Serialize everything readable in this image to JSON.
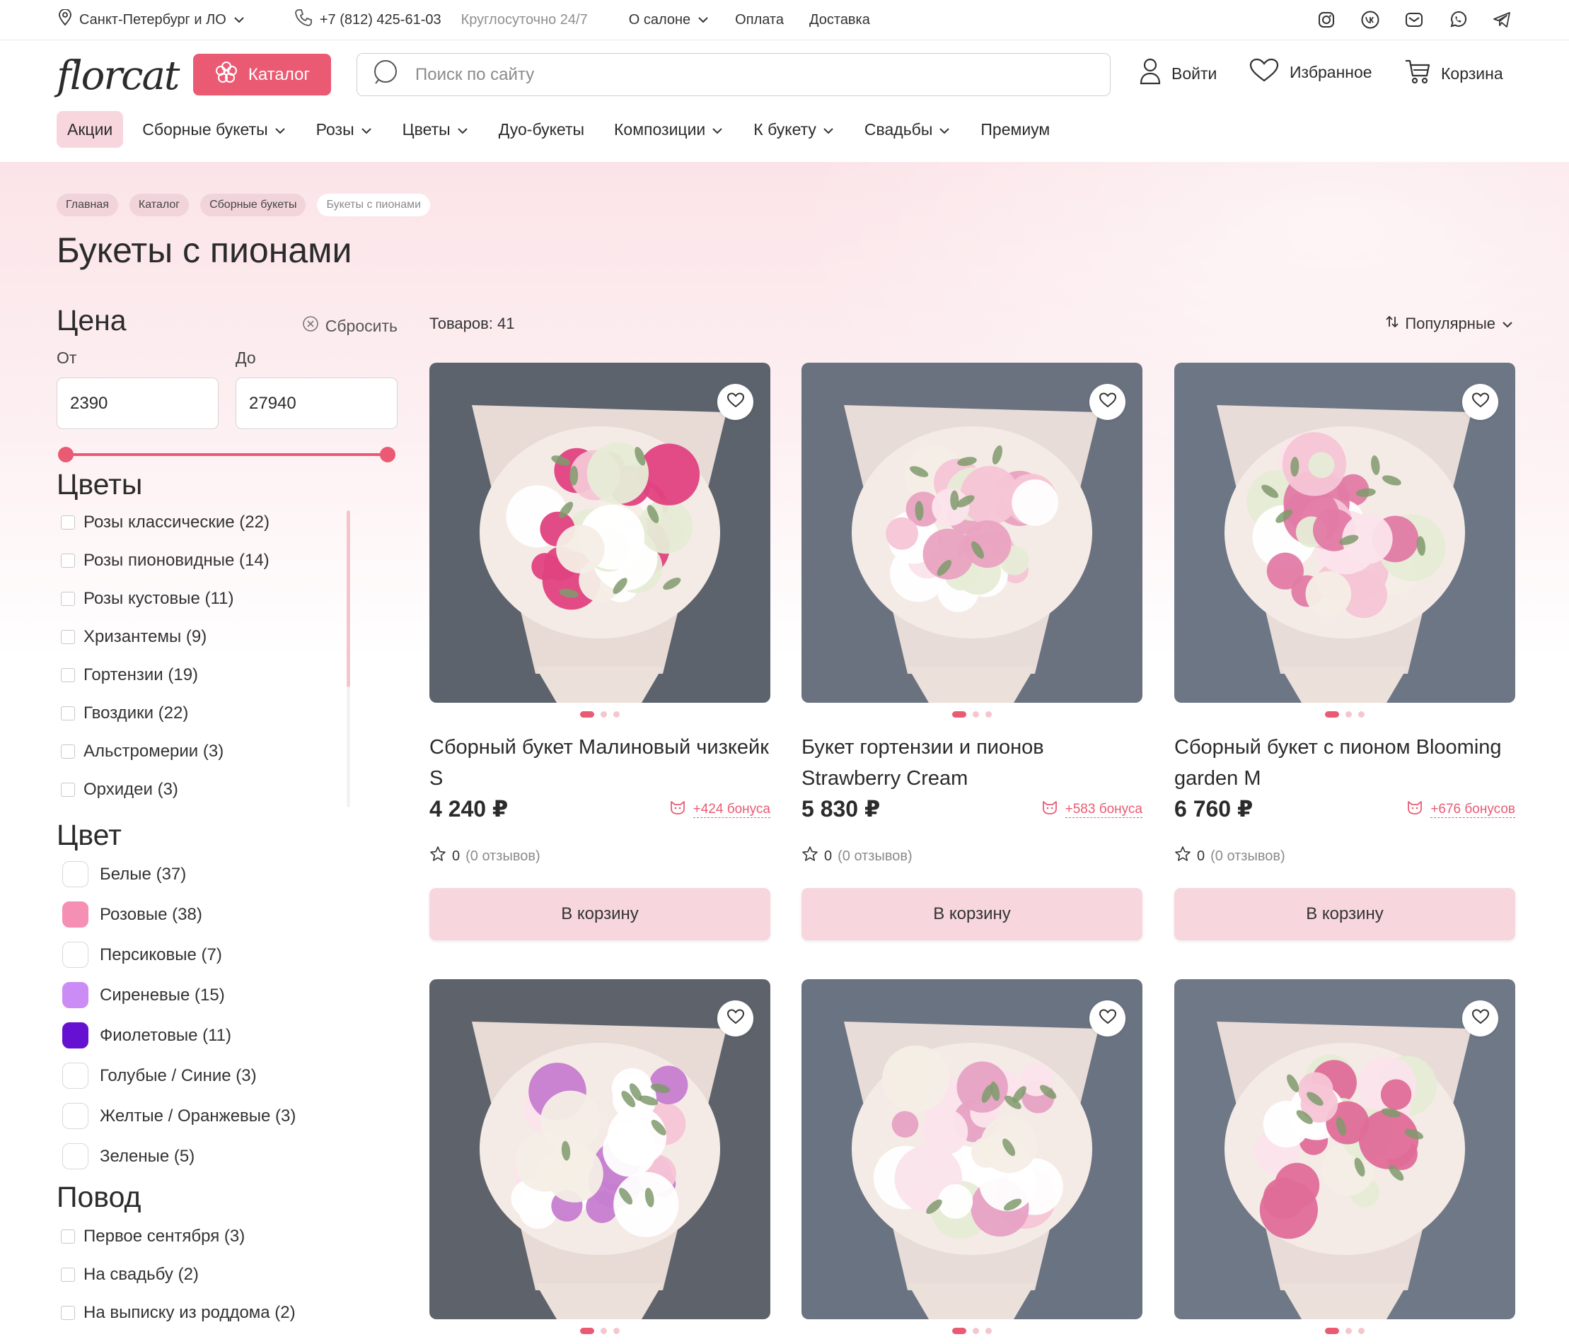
{
  "topbar": {
    "location": "Санкт-Петербург и ЛО",
    "phone": "+7 (812) 425-61-03",
    "hours": "Круглосуточно 24/7",
    "links": [
      "О салоне",
      "Оплата",
      "Доставка"
    ],
    "social": [
      "instagram-icon",
      "vk-icon",
      "mail-icon",
      "whatsapp-icon",
      "telegram-icon"
    ]
  },
  "header": {
    "logo": "florcat",
    "catalog": "Каталог",
    "search_placeholder": "Поиск по сайту",
    "login": "Войти",
    "favorites": "Избранное",
    "cart": "Корзина"
  },
  "nav": [
    {
      "label": "Акции",
      "dropdown": false,
      "active": true
    },
    {
      "label": "Сборные букеты",
      "dropdown": true
    },
    {
      "label": "Розы",
      "dropdown": true
    },
    {
      "label": "Цветы",
      "dropdown": true
    },
    {
      "label": "Дуо-букеты",
      "dropdown": false
    },
    {
      "label": "Композиции",
      "dropdown": true
    },
    {
      "label": "К букету",
      "dropdown": true
    },
    {
      "label": "Свадьбы",
      "dropdown": true
    },
    {
      "label": "Премиум",
      "dropdown": false
    }
  ],
  "breadcrumbs": [
    "Главная",
    "Каталог",
    "Сборные букеты",
    "Букеты с пионами"
  ],
  "page_title": "Букеты с пионами",
  "filters": {
    "price": {
      "title": "Цена",
      "reset": "Сбросить",
      "from_label": "От",
      "to_label": "До",
      "from": "2390",
      "to": "27940"
    },
    "flowers": {
      "title": "Цветы",
      "items": [
        "Розы классические (22)",
        "Розы пионовидные (14)",
        "Розы кустовые (11)",
        "Хризантемы (9)",
        "Гортензии (19)",
        "Гвоздики (22)",
        "Альстромерии (3)",
        "Орхидеи (3)"
      ]
    },
    "color": {
      "title": "Цвет",
      "items": [
        {
          "label": "Белые (37)",
          "swatch": "#ffffff"
        },
        {
          "label": "Розовые (38)",
          "swatch": "#f58fb3"
        },
        {
          "label": "Персиковые (7)",
          "swatch": "#ffffff"
        },
        {
          "label": "Сиреневые (15)",
          "swatch": "#cc8cf5"
        },
        {
          "label": "Фиолетовые (11)",
          "swatch": "#6610d1"
        },
        {
          "label": "Голубые / Синие (3)",
          "swatch": "#ffffff"
        },
        {
          "label": "Желтые / Оранжевые (3)",
          "swatch": "#ffffff"
        },
        {
          "label": "Зеленые (5)",
          "swatch": "#ffffff"
        }
      ]
    },
    "occasion": {
      "title": "Повод",
      "items": [
        "Первое сентября (3)",
        "На свадьбу (2)",
        "На выписку из роддома (2)"
      ]
    }
  },
  "listing": {
    "count": "Товаров: 41",
    "sort": "Популярные",
    "cart_label": "В корзину",
    "products": [
      {
        "name": "Сборный букет Малиновый чизкейк S",
        "price": "4 240 ₽",
        "bonus": "+424 бонуса",
        "rating": "0",
        "reviews": "(0 отзывов)",
        "bg": "#5c636c",
        "accent": "#e0427f"
      },
      {
        "name": "Букет гортензии и пионов Strawberry Cream",
        "price": "5 830 ₽",
        "bonus": "+583 бонуса",
        "rating": "0",
        "reviews": "(0 отзывов)",
        "bg": "#6a7280",
        "accent": "#e9a3c1"
      },
      {
        "name": "Сборный букет с пионом Blooming garden M",
        "price": "6 760 ₽",
        "bonus": "+676 бонусов",
        "rating": "0",
        "reviews": "(0 отзывов)",
        "bg": "#6d7685",
        "accent": "#e27ba5"
      },
      {
        "name": "",
        "bg": "#5e636b",
        "accent": "#c67dd0"
      },
      {
        "name": "",
        "bg": "#6a7382",
        "accent": "#e7a2c4"
      },
      {
        "name": "",
        "bg": "#6f7886",
        "accent": "#df6d98"
      }
    ]
  }
}
